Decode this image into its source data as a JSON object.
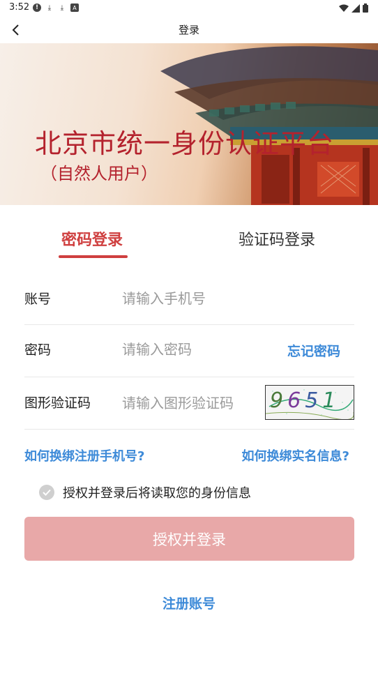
{
  "status_bar": {
    "time": "3:52"
  },
  "app_bar": {
    "title": "登录"
  },
  "banner": {
    "title": "北京市统一身份认证平台",
    "subtitle": "（自然人用户）"
  },
  "tabs": [
    {
      "label": "密码登录",
      "active": true
    },
    {
      "label": "验证码登录",
      "active": false
    }
  ],
  "form": {
    "account": {
      "label": "账号",
      "placeholder": "请输入手机号",
      "value": ""
    },
    "password": {
      "label": "密码",
      "placeholder": "请输入密码",
      "value": "",
      "forgot_label": "忘记密码"
    },
    "captcha": {
      "label": "图形验证码",
      "placeholder": "请输入图形验证码",
      "value": "",
      "image_text": "9651"
    }
  },
  "links": {
    "rebind_phone": "如何换绑注册手机号?",
    "rebind_realname": "如何换绑实名信息?"
  },
  "consent": {
    "text": "授权并登录后将读取您的身份信息",
    "checked": true
  },
  "login_button": {
    "label": "授权并登录"
  },
  "register_link": {
    "label": "注册账号"
  },
  "colors": {
    "brand_red": "#cf3f3f",
    "banner_red": "#b4222d",
    "link_blue": "#3d8ad8",
    "button_disabled": "#e8a8a8"
  }
}
